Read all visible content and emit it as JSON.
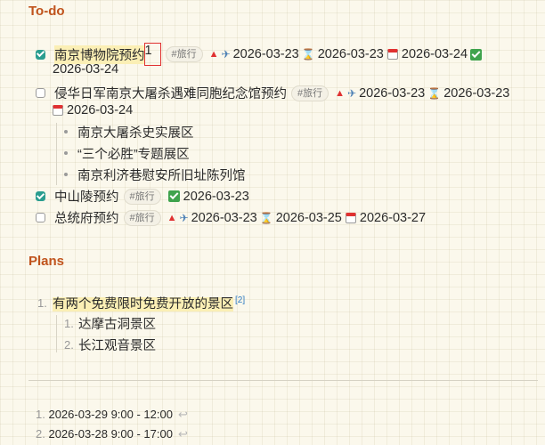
{
  "sections": {
    "todo_title": "To-do",
    "plans_title": "Plans"
  },
  "tasks": [
    {
      "done": true,
      "title": "南京博物院预约",
      "cursor_text": "1",
      "tag": "#旅行",
      "priority_icon": "red-triangle-icon",
      "start_icon": "airplane-departure-icon",
      "start": "2026-03-23",
      "scheduled_icon": "hourglass-icon",
      "scheduled": "2026-03-23",
      "due_icon": "calendar-icon",
      "due": "2026-03-24",
      "done_icon": "check-mark-icon",
      "done_date": "2026-03-24"
    },
    {
      "done": false,
      "title": "侵华日军南京大屠杀遇难同胞纪念馆预约",
      "tag": "#旅行",
      "start": "2026-03-23",
      "scheduled": "2026-03-23",
      "due": "2026-03-24",
      "subitems": [
        "南京大屠杀史实展区",
        "“三个必胜”专题展区",
        "南京利济巷慰安所旧址陈列馆"
      ]
    },
    {
      "done": true,
      "title": "中山陵预约",
      "tag": "#旅行",
      "done_date": "2026-03-23"
    },
    {
      "done": false,
      "title": "总统府预约",
      "tag": "#旅行",
      "start": "2026-03-23",
      "scheduled": "2026-03-25",
      "due": "2026-03-27"
    }
  ],
  "plans": {
    "item1": {
      "number": "1.",
      "text": "有两个免费限时免费开放的景区",
      "footnote": "[2]"
    },
    "subitems": [
      {
        "number": "1.",
        "text": "达摩古洞景区"
      },
      {
        "number": "2.",
        "text": "长江观音景区"
      }
    ]
  },
  "footnotes": [
    {
      "number": "1.",
      "text": "2026-03-29 9:00 - 12:00",
      "return_icon": "return-arrow-icon"
    },
    {
      "number": "2.",
      "text": "2026-03-28 9:00 - 17:00",
      "return_icon": "return-arrow-icon"
    }
  ]
}
